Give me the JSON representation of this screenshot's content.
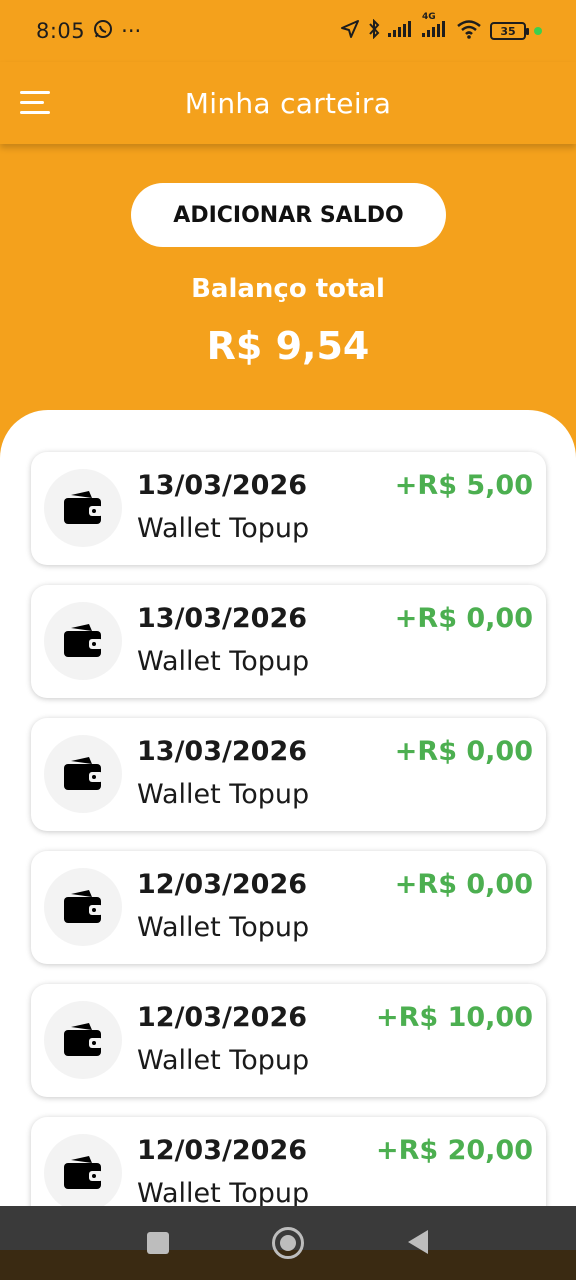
{
  "status_bar": {
    "time": "8:05",
    "extra": "···",
    "battery": "35",
    "network": "4G"
  },
  "app_bar": {
    "title": "Minha carteira"
  },
  "header": {
    "add_balance_label": "ADICIONAR SALDO",
    "balance_label": "Balanço total",
    "balance_value": "R$ 9,54"
  },
  "colors": {
    "brand": "#f4a11c",
    "positive": "#4caf50"
  },
  "transactions": [
    {
      "date": "13/03/2026",
      "description": "Wallet Topup",
      "amount": "+R$ 5,00",
      "icon": "wallet-icon"
    },
    {
      "date": "13/03/2026",
      "description": "Wallet Topup",
      "amount": "+R$ 0,00",
      "icon": "wallet-icon"
    },
    {
      "date": "13/03/2026",
      "description": "Wallet Topup",
      "amount": "+R$ 0,00",
      "icon": "wallet-icon"
    },
    {
      "date": "12/03/2026",
      "description": "Wallet Topup",
      "amount": "+R$ 0,00",
      "icon": "wallet-icon"
    },
    {
      "date": "12/03/2026",
      "description": "Wallet Topup",
      "amount": "+R$ 10,00",
      "icon": "wallet-icon"
    },
    {
      "date": "12/03/2026",
      "description": "Wallet Topup",
      "amount": "+R$ 20,00",
      "icon": "wallet-icon"
    }
  ]
}
